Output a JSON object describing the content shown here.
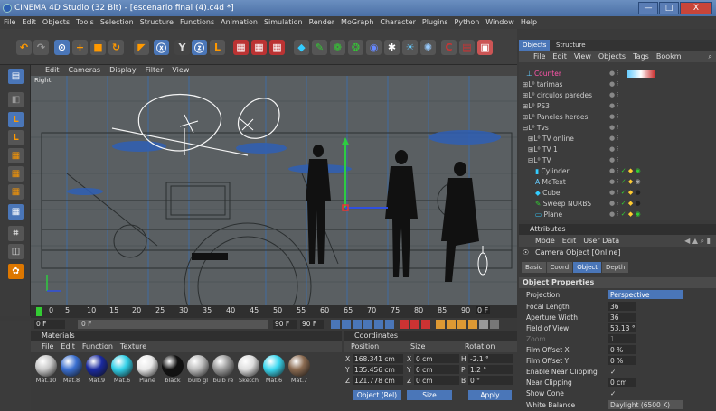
{
  "window": {
    "title": "CINEMA 4D Studio (32 Bit) - [escenario final (4).c4d *]",
    "minimize": "—",
    "maximize": "□",
    "close": "X"
  },
  "menubar": [
    "File",
    "Edit",
    "Objects",
    "Tools",
    "Selection",
    "Structure",
    "Functions",
    "Animation",
    "Simulation",
    "Render",
    "MoGraph",
    "Character",
    "Plugins",
    "Python",
    "Window",
    "Help"
  ],
  "viewport": {
    "menu": [
      "Edit",
      "Cameras",
      "Display",
      "Filter",
      "View"
    ],
    "view_label": "Right"
  },
  "timeline": {
    "ticks": [
      "0",
      "5",
      "10",
      "15",
      "20",
      "25",
      "30",
      "35",
      "40",
      "45",
      "50",
      "55",
      "60",
      "65",
      "70",
      "75",
      "80",
      "85",
      "90"
    ],
    "end_label": "0 F",
    "current_frame": "0 F",
    "start_field": "0 F",
    "end_field": "90 F",
    "end_field2": "90 F"
  },
  "objects_panel": {
    "tabs": [
      "Objects",
      "Structure"
    ],
    "menu": [
      "File",
      "Edit",
      "View",
      "Objects",
      "Tags",
      "Bookm"
    ],
    "items": [
      {
        "name": "Counter",
        "indent": 0
      },
      {
        "name": "tarimas",
        "indent": 0
      },
      {
        "name": "circulos paredes",
        "indent": 0
      },
      {
        "name": "PS3",
        "indent": 0
      },
      {
        "name": "Paneles heroes",
        "indent": 0
      },
      {
        "name": "Tvs",
        "indent": 0
      },
      {
        "name": "TV online",
        "indent": 1
      },
      {
        "name": "TV 1",
        "indent": 1
      },
      {
        "name": "TV",
        "indent": 1
      },
      {
        "name": "Cylinder",
        "indent": 2
      },
      {
        "name": "MoText",
        "indent": 2
      },
      {
        "name": "Cube",
        "indent": 2
      },
      {
        "name": "Sweep NURBS",
        "indent": 2
      },
      {
        "name": "Plane",
        "indent": 2
      }
    ]
  },
  "attributes": {
    "title": "Attributes",
    "menu": [
      "Mode",
      "Edit",
      "User Data"
    ],
    "object_name": "Camera Object [Online]",
    "tabs": [
      "Basic",
      "Coord",
      "Object",
      "Depth"
    ],
    "section": "Object Properties",
    "props": [
      {
        "label": "Projection",
        "value": "Perspective"
      },
      {
        "label": "Focal Length",
        "value": "36"
      },
      {
        "label": "Aperture Width",
        "value": "36"
      },
      {
        "label": "Field of View",
        "value": "53.13 °"
      },
      {
        "label": "Zoom",
        "value": "1"
      },
      {
        "label": "Film Offset X",
        "value": "0 %"
      },
      {
        "label": "Film Offset Y",
        "value": "0 %"
      },
      {
        "label": "Enable Near Clipping",
        "value": "✓"
      },
      {
        "label": "Near Clipping",
        "value": "0 cm"
      },
      {
        "label": "Show Cone",
        "value": "✓"
      },
      {
        "label": "White Balance",
        "value": "Daylight (6500 K)"
      }
    ]
  },
  "materials": {
    "title": "Materials",
    "menu": [
      "File",
      "Edit",
      "Function",
      "Texture"
    ],
    "items": [
      {
        "name": "Mat.10",
        "color": "#c8c8c8"
      },
      {
        "name": "Mat.8",
        "color": "#3a6fd0"
      },
      {
        "name": "Mat.9",
        "color": "#1a2aa0"
      },
      {
        "name": "Mat.6",
        "color": "#30d0e8"
      },
      {
        "name": "Plane",
        "color": "#e8e8e8"
      },
      {
        "name": "black",
        "color": "#111111"
      },
      {
        "name": "bulb gl",
        "color": "#bbbbbb"
      },
      {
        "name": "bulb re",
        "color": "#999999"
      },
      {
        "name": "Sketch",
        "color": "#dddddd"
      },
      {
        "name": "Mat.6",
        "color": "#3ad8f0"
      },
      {
        "name": "Mat.7",
        "color": "#8a6a50"
      }
    ]
  },
  "coordinates": {
    "title": "Coordinates",
    "columns": [
      "Position",
      "Size",
      "Rotation"
    ],
    "rows": [
      {
        "axis": "X",
        "pos": "168.341 cm",
        "size": "0 cm",
        "rl": "H",
        "rot": "-2.1 °"
      },
      {
        "axis": "Y",
        "pos": "135.456 cm",
        "size": "0 cm",
        "rl": "P",
        "rot": "1.2 °"
      },
      {
        "axis": "Z",
        "pos": "121.778 cm",
        "size": "0 cm",
        "rl": "B",
        "rot": "0 °"
      }
    ],
    "mode": "Object (Rel)",
    "size_mode": "Size",
    "apply": "Apply"
  },
  "colors": {
    "accent": "#4a76b8",
    "viewport_bg": "#5a5f62"
  }
}
